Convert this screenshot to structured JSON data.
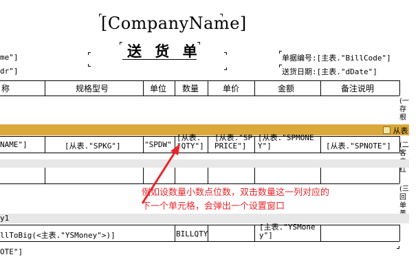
{
  "header": {
    "company_name": "[CompanyName]",
    "title": "送 货 单",
    "left_field_1": "me\"]",
    "left_field_2": "dr\"]",
    "bill_code": "单据编号:[主表.\"BillCode\"]",
    "bill_date": "送货日期:[主表.\"dDate\"]"
  },
  "columns": [
    "称",
    "规格型号",
    "单位",
    "数量",
    "单价",
    "金额",
    "备注说明"
  ],
  "band": {
    "label": "从表"
  },
  "detail_row": {
    "name": "NAME\"]",
    "spkg": "[从表.\"SPKG\"]",
    "spdw": "\"SPDW\"",
    "qty": "[从表.\n\"QTY\"]",
    "price": "[从表.\"SP\nPRICE\"]",
    "money": "[从表.\"SPMONE\nY\"]",
    "note": "[从表.\"SPNOTE\"]"
  },
  "side_labels": [
    "(一\n存\n根",
    "(二\n客\n户\n红",
    "(三\n回\n单\n黄"
  ],
  "footer": {
    "label": "y1",
    "big_money": "llToBig(<主表.\"YSMoney\">)]",
    "bill_qty": "BILLQTY",
    "ys_money": "[主表.\"YSMone\ny\"]",
    "note": "OTE\"]"
  },
  "annotation": "例如设数量小数点位数，双击数量这一列对应的\n下一个单元格，会弹出一个设置窗口",
  "colors": {
    "gold": "#dba83a",
    "gray": "#e7e7e7",
    "annotation": "#e8262a"
  }
}
